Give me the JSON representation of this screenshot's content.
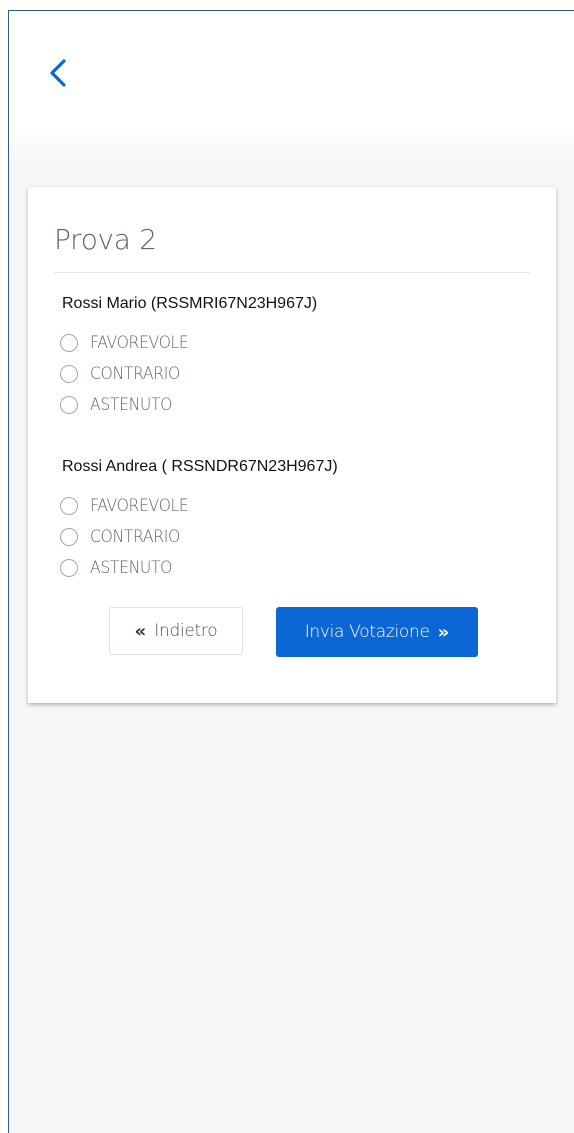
{
  "header": {
    "back_icon": "chevron-left-icon",
    "accent_color": "#0b66d6"
  },
  "card": {
    "title": "Prova 2",
    "voters": [
      {
        "name": "Rossi Mario (RSSMRI67N23H967J)",
        "options": [
          "FAVOREVOLE",
          "CONTRARIO",
          "ASTENUTO"
        ],
        "selected": null
      },
      {
        "name": "Rossi Andrea ( RSSNDR67N23H967J)",
        "options": [
          "FAVOREVOLE",
          "CONTRARIO",
          "ASTENUTO"
        ],
        "selected": null
      }
    ],
    "actions": {
      "back_label": "Indietro",
      "back_icon": "double-chevron-left-icon",
      "submit_label": "Invia Votazione",
      "submit_icon": "double-chevron-right-icon",
      "submit_color": "#0b66d6"
    }
  }
}
